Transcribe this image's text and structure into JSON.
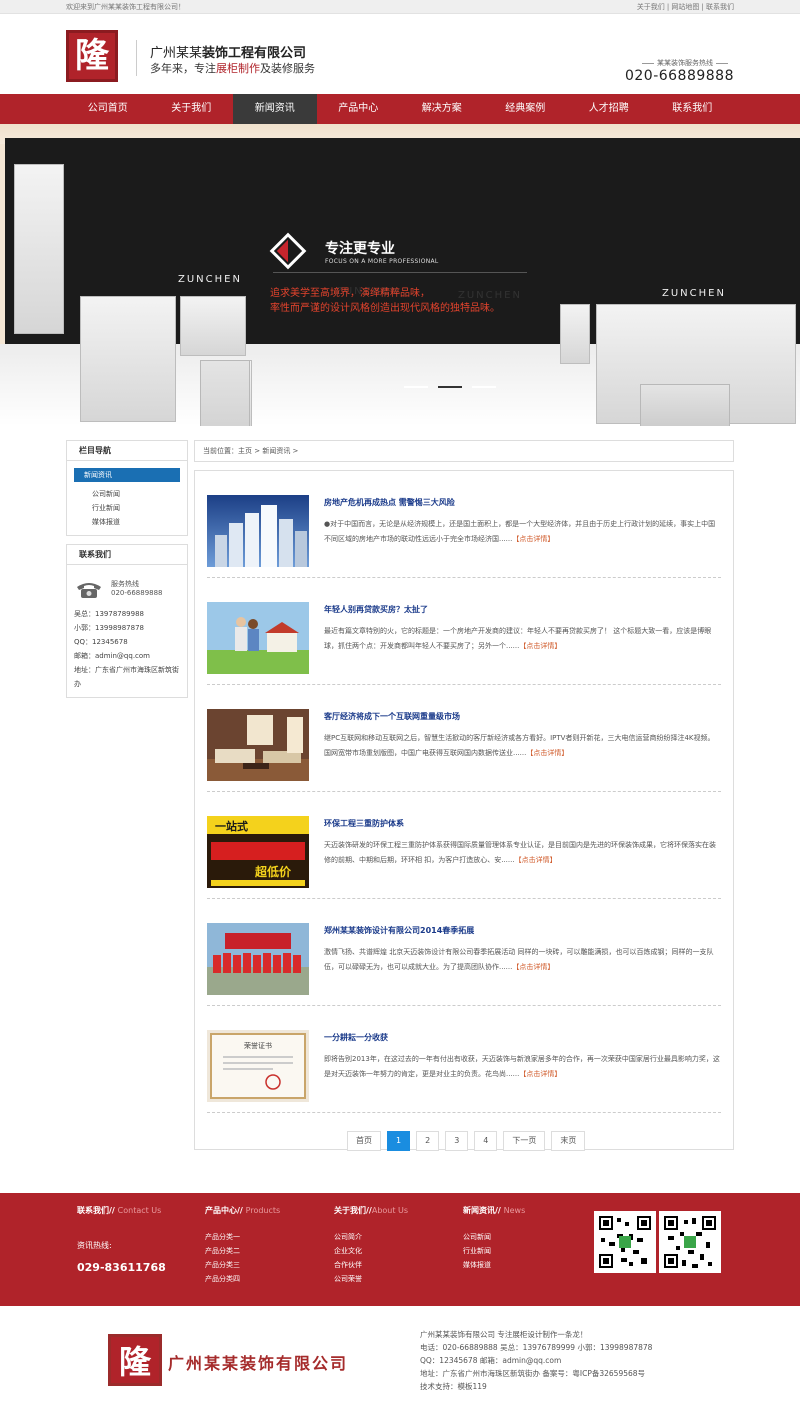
{
  "topbar": {
    "welcome": "欢迎来到广州某某装饰工程有限公司！",
    "links": [
      "关于我们",
      "网站地图",
      "联系我们"
    ]
  },
  "header": {
    "logo_glyph": "隆",
    "company_name_light": "广州某某",
    "company_name_bold": "装饰工程有限公司",
    "slogan_a": "多年来，专注",
    "slogan_b": "展柜制作",
    "slogan_c": "及装修服务",
    "hotline_label": "某某装饰服务热线",
    "hotline_number": "020-66889888"
  },
  "nav": {
    "items": [
      "公司首页",
      "关于我们",
      "新闻资讯",
      "产品中心",
      "解决方案",
      "经典案例",
      "人才招聘",
      "联系我们"
    ],
    "active_index": 2
  },
  "banner": {
    "brand": "ZUNCHEN",
    "title": "专注更专业",
    "subtitle": "FOCUS ON A MORE PROFESSIONAL",
    "line1": "追求美学至高境界，演绎精粹品味，",
    "line2": "率性而严谨的设计风格创造出现代风格的独特品味。",
    "accent": "#c6252d"
  },
  "sidebar": {
    "nav_title": "栏目导航",
    "current": "新闻资讯",
    "items": [
      "公司新闻",
      "行业新闻",
      "媒体报道"
    ],
    "contact_title": "联系我们",
    "phone_label": "服务热线",
    "phone_number": "020-66889888",
    "lines": [
      "吴总：13978789988",
      "小郭：13998987878",
      "QQ：12345678",
      "邮箱：admin@qq.com"
    ],
    "address": "地址：广东省广州市海珠区新筑街办"
  },
  "breadcrumb": "当前位置：主页 > 新闻资讯 >",
  "news": [
    {
      "title": "房地产危机再成热点 需警惕三大风险",
      "desc": "●对于中国而言，无论是从经济规模上，还是国土面积上，都是一个大型经济体，并且由于历史上行政计划的延续，事实上中国不同区域的房地产市场的联动性远远小于完全市场经济国......",
      "more": "【点击详情】",
      "thumb": "buildings"
    },
    {
      "title": "年轻人别再贷款买房？太扯了",
      "desc": "最近有篇文章特别的火，它的标题是：一个房地产开发商的建议：年轻人不要再贷款买房了！ 这个标题大致一看，应该是博眼球，抓住两个点：开发商都叫年轻人不要买房了；另外一个......",
      "more": "【点击详情】",
      "thumb": "couple"
    },
    {
      "title": "客厅经济将成下一个互联网重量级市场",
      "desc": "继PC互联网和移动互联网之后，智慧生活掀动的客厅新经济或各方看好。IPTV者则开新花，三大电信运营商纷纷择注4K视频。国网宽带市场重划版图，中国广电获得互联网国内数据传送业......",
      "more": "【点击详情】",
      "thumb": "livingroom"
    },
    {
      "title": "环保工程三重防护体系",
      "desc": "天迈装饰研发的环保工程三重防护体系获得国际质量管理体系专业认证，是目前国内是先进的环保装饰成果，它将环保落实在装修的前期、中期和后期，环环相 扣，为客户打造放心、安......",
      "more": "【点击详情】",
      "thumb": "poster",
      "thumb_text_a": "一站式",
      "thumb_text_b": "超低价"
    },
    {
      "title": "郑州某某装饰设计有限公司2014春季拓展",
      "desc": "激情飞扬、共谱辉煌 北京天迈装饰设计有限公司春季拓展活动 同样的一块砖，可以雕能满损，也可以百炼成钢；同样的一支队伍，可以碌碌无为，也可以成就大业。为了提高团队协作......",
      "more": "【点击详情】",
      "thumb": "team"
    },
    {
      "title": "一分耕耘一分收获",
      "desc": "即将告别2013年，在这过去的一年有付出有收获，天迈装饰与新浪家居多年的合作，再一次荣获中国家居行业最具影响力奖，这是对天迈装饰一年努力的肯定，更是对业主的负责。花鸟尚......",
      "more": "【点击详情】",
      "thumb": "certificate",
      "thumb_text_a": "荣誉证书"
    }
  ],
  "pager": [
    "首页",
    "1",
    "2",
    "3",
    "4",
    "下一页",
    "末页"
  ],
  "pager_current": "1",
  "footer": {
    "contact_h": "联系我们//",
    "contact_en": "Contact Us",
    "tel_label": "资讯热线:",
    "tel_number": "029-83611768",
    "products_h": "产品中心//",
    "products_en": "Products",
    "products": [
      "产品分类一",
      "产品分类二",
      "产品分类三",
      "产品分类四"
    ],
    "about_h": "关于我们//",
    "about_en": "About Us",
    "about": [
      "公司简介",
      "企业文化",
      "合作伙伴",
      "公司荣誉"
    ],
    "news_h": "新闻资讯//",
    "news_en": "News",
    "news": [
      "公司新闻",
      "行业新闻",
      "媒体报道"
    ]
  },
  "bottom": {
    "logo_glyph": "隆",
    "name": "广州某某装饰有限公司",
    "info": [
      "广州某某装饰有限公司    专注展柜设计制作一条龙！",
      "电话：020-66889888    吴总：13976789999    小郭：13998987878",
      "QQ：12345678    邮箱：admin@qq.com",
      "地址：广东省广州市海珠区新筑街办    备案号：粤ICP备32659568号",
      "技术支持：模板119"
    ]
  },
  "colors": {
    "brand_red": "#b0232a",
    "nav_active": "#3a3a3a",
    "link_blue": "#1a3a8a",
    "pager_active": "#1a8de0"
  }
}
